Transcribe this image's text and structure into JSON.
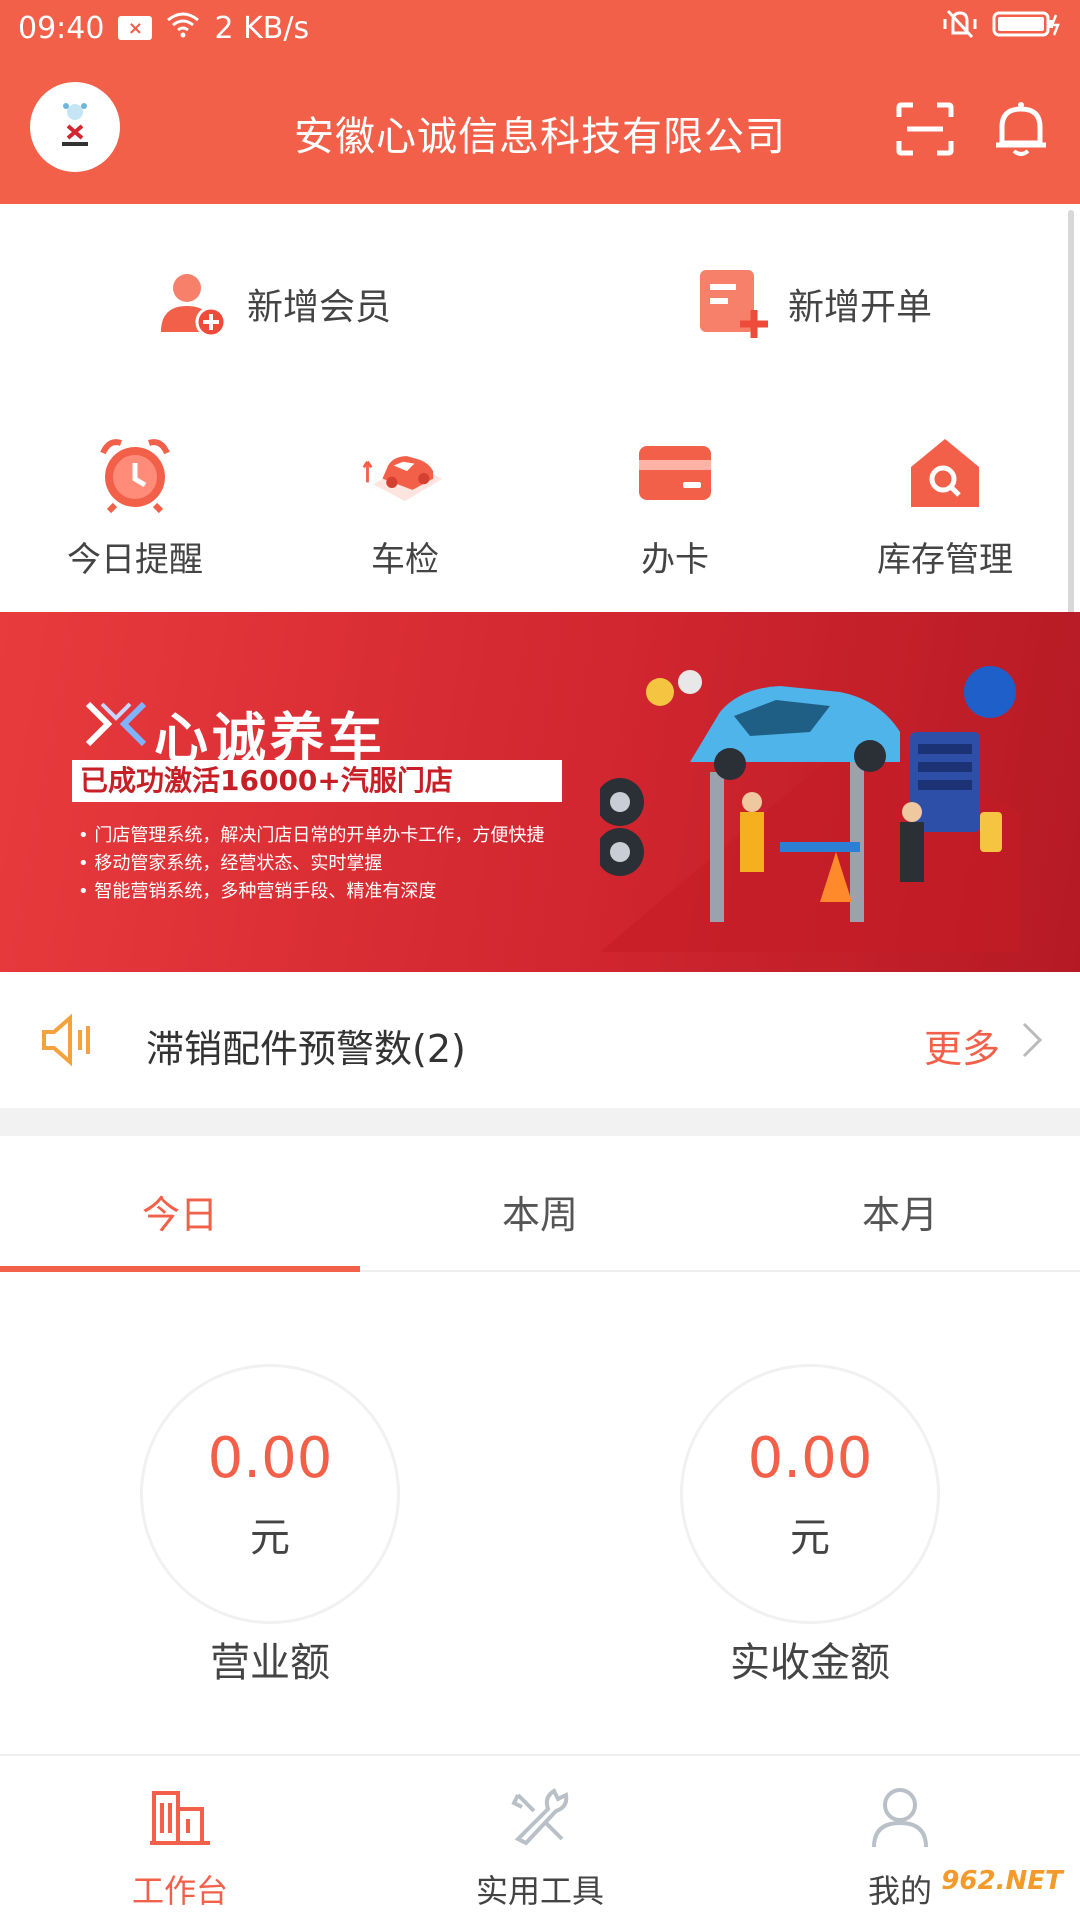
{
  "status_bar": {
    "time": "09:40",
    "net_speed": "2 KB/s",
    "notification_badge": "×"
  },
  "header": {
    "title": "安徽心诚信息科技有限公司",
    "avatar_icon": "company-logo",
    "scan_icon": "scan-icon",
    "bell_icon": "bell-icon"
  },
  "quick_actions": [
    {
      "label": "新增会员",
      "icon": "add-member-icon"
    },
    {
      "label": "新增开单",
      "icon": "add-order-icon"
    }
  ],
  "grid": [
    {
      "label": "今日提醒",
      "icon": "alarm-clock-icon"
    },
    {
      "label": "车检",
      "icon": "car-inspection-icon"
    },
    {
      "label": "办卡",
      "icon": "card-icon"
    },
    {
      "label": "库存管理",
      "icon": "warehouse-icon"
    }
  ],
  "banner": {
    "title": "心诚养车",
    "headline": "已成功激活16000+汽服门店",
    "bullets": [
      "• 门店管理系统，解决门店日常的开单办卡工作，方便快捷",
      "• 移动管家系统，经营状态、实时掌握",
      "• 智能营销系统，多种营销手段、精准有深度"
    ]
  },
  "warning": {
    "text": "滞销配件预警数(2)",
    "more": "更多"
  },
  "tabs": [
    {
      "label": "今日",
      "active": true
    },
    {
      "label": "本周",
      "active": false
    },
    {
      "label": "本月",
      "active": false
    }
  ],
  "stats": [
    {
      "value": "0.00",
      "unit": "元",
      "label": "营业额"
    },
    {
      "value": "0.00",
      "unit": "元",
      "label": "实收金额"
    }
  ],
  "bottom_nav": [
    {
      "label": "工作台",
      "icon": "workbench-icon",
      "active": true
    },
    {
      "label": "实用工具",
      "icon": "tools-icon",
      "active": false
    },
    {
      "label": "我的",
      "icon": "user-icon",
      "active": false
    }
  ],
  "watermark": "962.NET",
  "colors": {
    "primary": "#f26049",
    "banner": "#d22630",
    "text": "#444444"
  }
}
